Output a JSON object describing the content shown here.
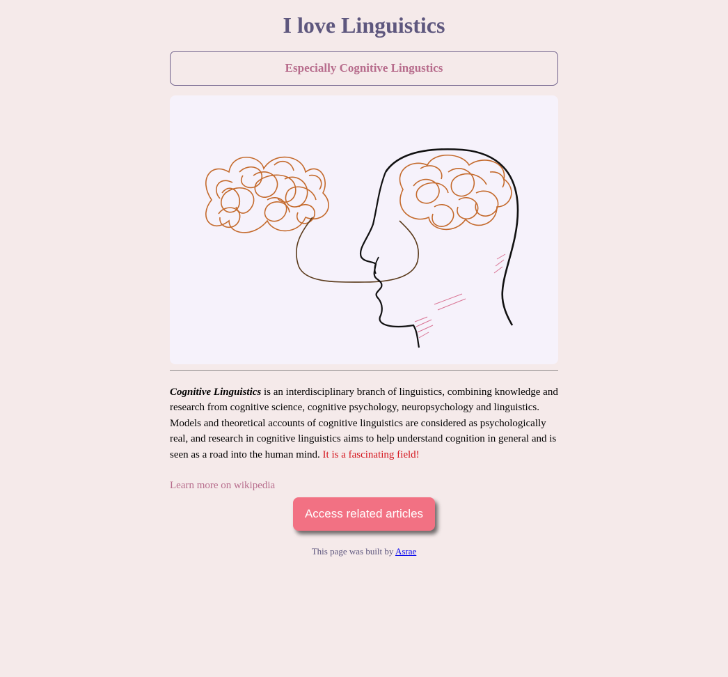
{
  "header": {
    "title": "I love Linguistics",
    "subtitle": "Especially Cognitive Lingustics"
  },
  "illustration": {
    "icon": "head-with-tangled-brain-illustration"
  },
  "description": {
    "term": "Cognitive Linguistics",
    "body": " is an interdisciplinary branch of linguistics, combining knowledge and research from cognitive science, cognitive psychology, neuropsychology and linguistics. Models and theoretical accounts of cognitive linguistics are considered as psychologically real, and research in cognitive linguistics aims to help understand cognition in general and is seen as a road into the human mind. ",
    "highlight": "It is a fascinating field!"
  },
  "links": {
    "wikipedia_label": "Learn more on wikipedia"
  },
  "cta": {
    "button_label": "Access related articles"
  },
  "footer": {
    "prefix": "This page was built by ",
    "author": "Asrae"
  },
  "colors": {
    "background": "#f5eaea",
    "title": "#5e577e",
    "accent": "#b76c8c",
    "button": "#f27183",
    "highlight": "#d4131b"
  }
}
